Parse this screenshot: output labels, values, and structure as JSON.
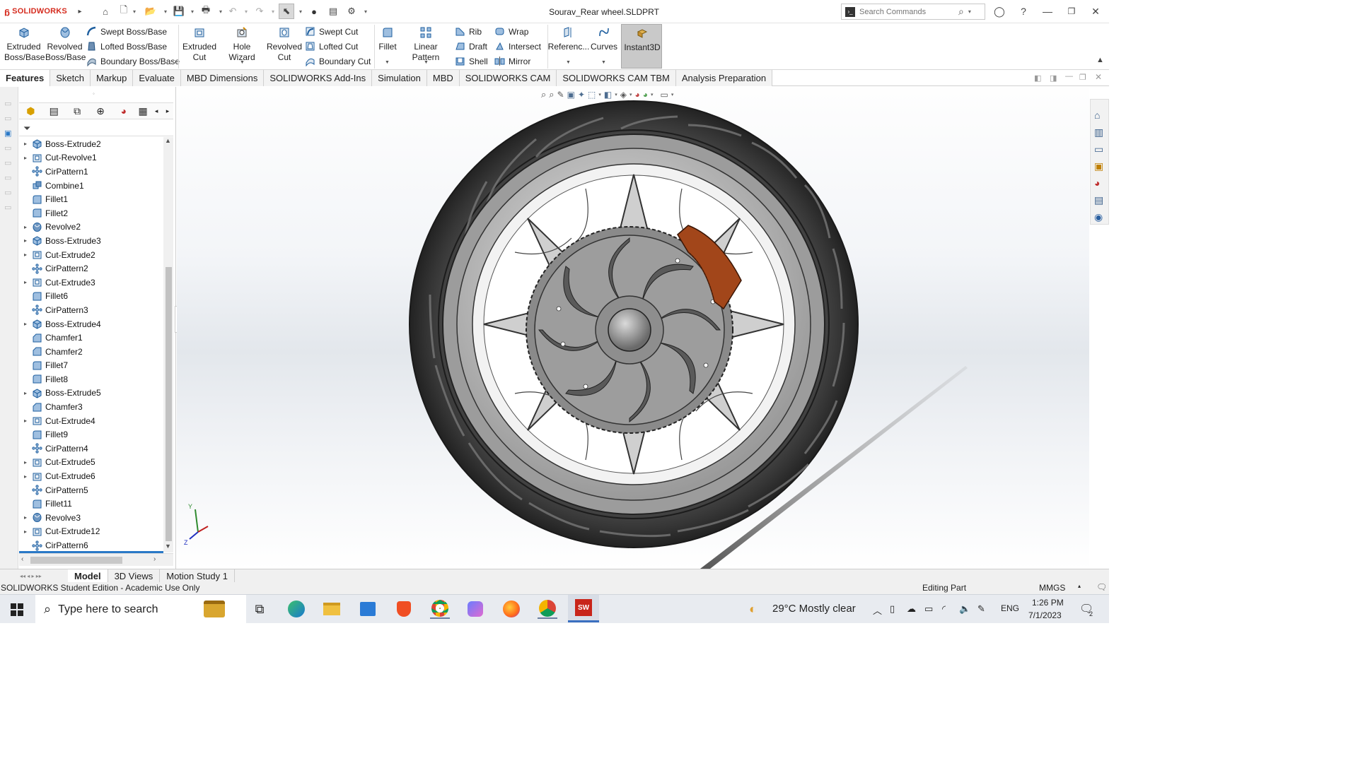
{
  "app": {
    "name": "SOLIDWORKS",
    "document_title": "Sourav_Rear wheel.SLDPRT"
  },
  "search": {
    "placeholder": "Search Commands"
  },
  "ribbon": {
    "extruded_boss": "Extruded Boss/Base",
    "revolved_boss": "Revolved Boss/Base",
    "swept_boss": "Swept Boss/Base",
    "lofted_boss": "Lofted Boss/Base",
    "boundary_boss": "Boundary Boss/Base",
    "extruded_cut": "Extruded Cut",
    "hole_wizard": "Hole Wizard",
    "revolved_cut": "Revolved Cut",
    "swept_cut": "Swept Cut",
    "lofted_cut": "Lofted Cut",
    "boundary_cut": "Boundary Cut",
    "fillet": "Fillet",
    "linear_pattern": "Linear Pattern",
    "rib": "Rib",
    "draft": "Draft",
    "shell": "Shell",
    "wrap": "Wrap",
    "intersect": "Intersect",
    "mirror": "Mirror",
    "reference": "Referenc...",
    "curves": "Curves",
    "instant3d": "Instant3D"
  },
  "command_tabs": [
    "Features",
    "Sketch",
    "Markup",
    "Evaluate",
    "MBD Dimensions",
    "SOLIDWORKS Add-Ins",
    "Simulation",
    "MBD",
    "SOLIDWORKS CAM",
    "SOLIDWORKS CAM TBM",
    "Analysis Preparation"
  ],
  "feature_tree": [
    {
      "name": "Boss-Extrude2",
      "icon": "extrude-icon",
      "expandable": true
    },
    {
      "name": "Cut-Revolve1",
      "icon": "cut-icon",
      "expandable": true
    },
    {
      "name": "CirPattern1",
      "icon": "pattern-icon",
      "expandable": false
    },
    {
      "name": "Combine1",
      "icon": "combine-icon",
      "expandable": false
    },
    {
      "name": "Fillet1",
      "icon": "fillet-icon",
      "expandable": false
    },
    {
      "name": "Fillet2",
      "icon": "fillet-icon",
      "expandable": false
    },
    {
      "name": "Revolve2",
      "icon": "revolve-icon",
      "expandable": true
    },
    {
      "name": "Boss-Extrude3",
      "icon": "extrude-icon",
      "expandable": true
    },
    {
      "name": "Cut-Extrude2",
      "icon": "cut-icon",
      "expandable": true
    },
    {
      "name": "CirPattern2",
      "icon": "pattern-icon",
      "expandable": false
    },
    {
      "name": "Cut-Extrude3",
      "icon": "cut-icon",
      "expandable": true
    },
    {
      "name": "Fillet6",
      "icon": "fillet-icon",
      "expandable": false
    },
    {
      "name": "CirPattern3",
      "icon": "pattern-icon",
      "expandable": false
    },
    {
      "name": "Boss-Extrude4",
      "icon": "extrude-icon",
      "expandable": true
    },
    {
      "name": "Chamfer1",
      "icon": "chamfer-icon",
      "expandable": false
    },
    {
      "name": "Chamfer2",
      "icon": "chamfer-icon",
      "expandable": false
    },
    {
      "name": "Fillet7",
      "icon": "fillet-icon",
      "expandable": false
    },
    {
      "name": "Fillet8",
      "icon": "fillet-icon",
      "expandable": false
    },
    {
      "name": "Boss-Extrude5",
      "icon": "extrude-icon",
      "expandable": true
    },
    {
      "name": "Chamfer3",
      "icon": "chamfer-icon",
      "expandable": false
    },
    {
      "name": "Cut-Extrude4",
      "icon": "cut-icon",
      "expandable": true
    },
    {
      "name": "Fillet9",
      "icon": "fillet-icon",
      "expandable": false
    },
    {
      "name": "CirPattern4",
      "icon": "pattern-icon",
      "expandable": false
    },
    {
      "name": "Cut-Extrude5",
      "icon": "cut-icon",
      "expandable": true
    },
    {
      "name": "Cut-Extrude6",
      "icon": "cut-icon",
      "expandable": true
    },
    {
      "name": "CirPattern5",
      "icon": "pattern-icon",
      "expandable": false
    },
    {
      "name": "Fillet11",
      "icon": "fillet-icon",
      "expandable": false
    },
    {
      "name": "Revolve3",
      "icon": "revolve-icon",
      "expandable": true
    },
    {
      "name": "Cut-Extrude12",
      "icon": "cut-icon",
      "expandable": true
    },
    {
      "name": "CirPattern6",
      "icon": "pattern-icon",
      "expandable": false
    }
  ],
  "triad": {
    "y": "Y",
    "z": "Z"
  },
  "bottom_tabs": [
    "Model",
    "3D Views",
    "Motion Study 1"
  ],
  "status": {
    "left": "SOLIDWORKS Student Edition - Academic Use Only",
    "mode": "Editing Part",
    "units": "MMGS"
  },
  "taskbar": {
    "search_placeholder": "Type here to search",
    "weather": "29°C  Mostly clear",
    "language": "ENG",
    "time": "1:26 PM",
    "date": "7/1/2023",
    "notifications": "2"
  },
  "colors": {
    "accent": "#2a79c7",
    "brand": "#d52b1e",
    "tire": "#3a3a3a",
    "caliper": "#a2461a",
    "rim": "#bdbdbd"
  }
}
